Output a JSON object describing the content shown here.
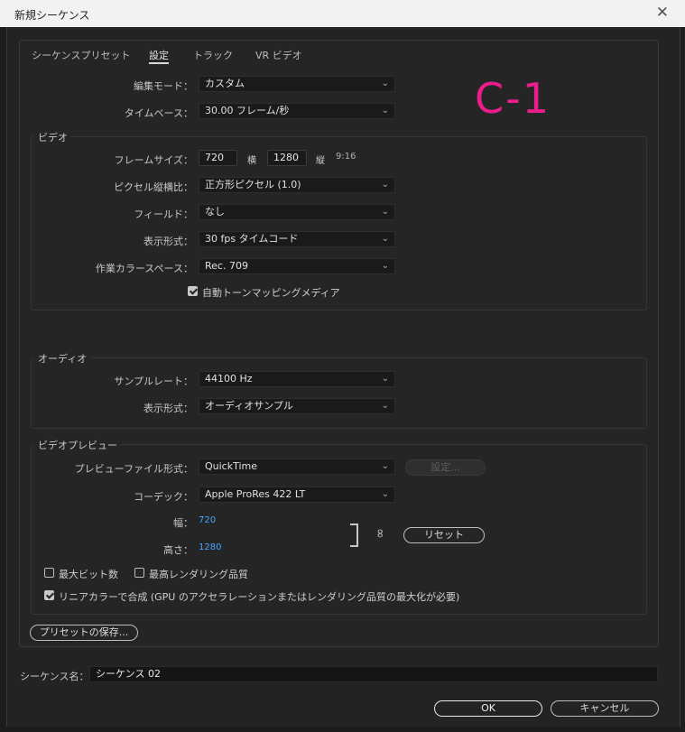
{
  "window": {
    "title": "新規シーケンス"
  },
  "tabs": [
    {
      "label": "シーケンスプリセット"
    },
    {
      "label": "設定"
    },
    {
      "label": "トラック"
    },
    {
      "label": "VR ビデオ"
    }
  ],
  "annotation": "C-1",
  "settings": {
    "edit_mode_label": "編集モード：",
    "edit_mode_value": "カスタム",
    "timebase_label": "タイムベース：",
    "timebase_value": "30.00  フレーム/秒"
  },
  "video": {
    "title": "ビデオ",
    "frame_size_label": "フレームサイズ：",
    "width_value": "720",
    "width_unit": "横",
    "height_value": "1280",
    "height_unit": "縦",
    "aspect": "9:16",
    "pixel_aspect_label": "ピクセル縦横比：",
    "pixel_aspect_value": "正方形ピクセル (1.0)",
    "fields_label": "フィールド：",
    "fields_value": "なし",
    "display_format_label": "表示形式：",
    "display_format_value": "30 fps タイムコード",
    "color_space_label": "作業カラースペース：",
    "color_space_value": "Rec. 709",
    "tonemap_label": "自動トーンマッピングメディア"
  },
  "audio": {
    "title": "オーディオ",
    "sample_rate_label": "サンプルレート：",
    "sample_rate_value": "44100 Hz",
    "display_format_label": "表示形式：",
    "display_format_value": "オーディオサンプル"
  },
  "video_preview": {
    "title": "ビデオプレビュー",
    "file_format_label": "プレビューファイル形式：",
    "file_format_value": "QuickTime",
    "settings_button": "設定...",
    "codec_label": "コーデック：",
    "codec_value": "Apple ProRes 422 LT",
    "width_label": "幅：",
    "width_value": "720",
    "height_label": "高さ：",
    "height_value": "1280",
    "reset_button": "リセット",
    "max_bit_depth": "最大ビット数",
    "max_render_quality": "最高レンダリング品質",
    "linear_color": "リニアカラーで合成 (GPU のアクセラレーションまたはレンダリング品質の最大化が必要)"
  },
  "save_preset_button": "プリセットの保存...",
  "sequence_name_label": "シーケンス名：",
  "sequence_name_value": "シーケンス 02",
  "ok_button": "OK",
  "cancel_button": "キャンセル"
}
